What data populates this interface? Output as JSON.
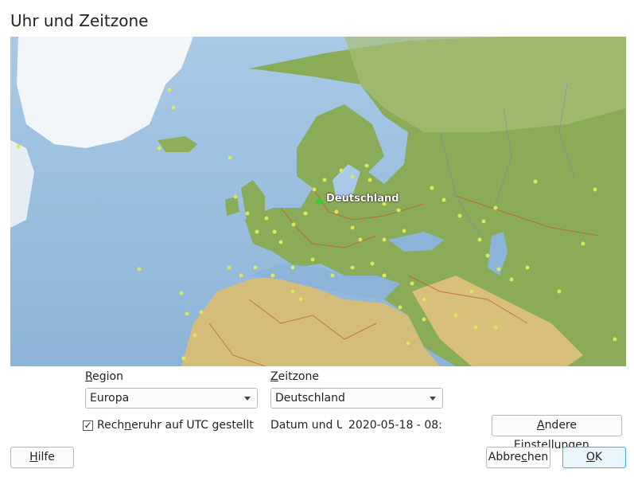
{
  "window": {
    "title": "Uhr und Zeitzone"
  },
  "map": {
    "selected_label": "Deutschland",
    "colors": {
      "ocean": "#b9d4ea",
      "deep_ocean": "#8fb6d8",
      "land": "#8fb05a",
      "desert": "#d8c07a",
      "ice": "#f4f7f9",
      "border": "#c0603a",
      "dot": "#d9e85c",
      "selected_dot": "#2fd22f"
    }
  },
  "region": {
    "label_prefix": "",
    "label_mnemonic": "R",
    "label_rest": "egion",
    "value": "Europa"
  },
  "timezone": {
    "label_mnemonic": "Z",
    "label_rest": "eitzone",
    "value": "Deutschland"
  },
  "utc_checkbox": {
    "checked": true,
    "check_glyph": "✓",
    "label_pre": "Rech",
    "label_mnemonic": "n",
    "label_post": "eruhr auf UTC gestellt"
  },
  "datetime": {
    "label": "Datum und U",
    "value": "2020-05-18 - 08:"
  },
  "other_settings_button": {
    "label_mnemonic": "A",
    "label_rest": "ndere Einstellungen..."
  },
  "help_button": {
    "label_mnemonic": "H",
    "label_rest": "ilfe"
  },
  "cancel_button": {
    "label_pre": "Abbre",
    "label_mnemonic": "c",
    "label_post": "hen"
  },
  "ok_button": {
    "label_mnemonic": "O",
    "label_rest": "K"
  }
}
